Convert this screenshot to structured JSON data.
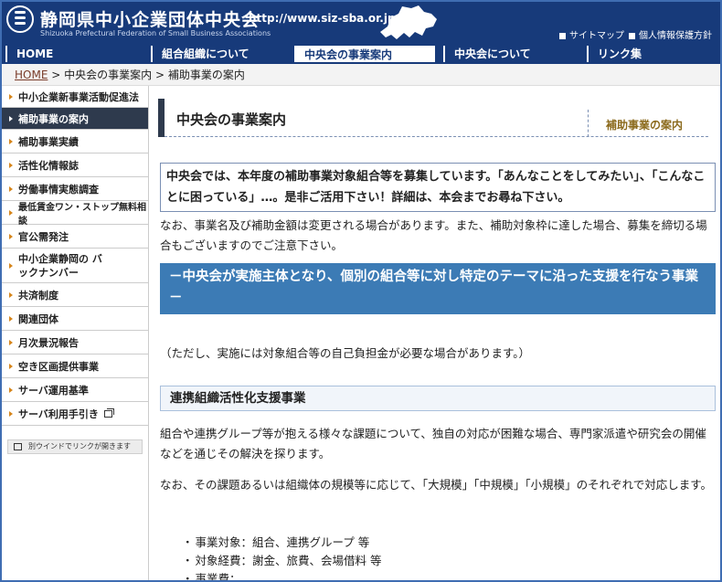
{
  "header": {
    "title": "静岡県中小企業団体中央会",
    "url": "http://www.siz-sba.or.jp/",
    "subtitle": "Shizuoka Prefectural Federation of Small Business Associations",
    "links": [
      "サイトマップ",
      "個人情報保護方針"
    ]
  },
  "nav": {
    "tabs": [
      "HOME",
      "組合組織について",
      "中央会の事業案内",
      "中央会について",
      "リンク集"
    ],
    "active_index": 2
  },
  "breadcrumb": {
    "home": "HOME",
    "sep": ">",
    "items": [
      "中央会の事業案内",
      "補助事業の案内"
    ]
  },
  "sidebar": {
    "items": [
      "中小企業新事業活動促進法",
      "補助事業の案内",
      "補助事業実績",
      "活性化情報誌",
      "労働事情実態調査",
      "最低賃金ワン・ストップ無料相談",
      "官公需発注",
      "中小企業静岡の バックナンバー",
      "共済制度",
      "関連団体",
      "月次景況報告",
      "空き区画提供事業",
      "サーバ運用基準",
      "サーバ利用手引き"
    ],
    "active_index": 1,
    "note": "別ウインドでリンクが開きます"
  },
  "main": {
    "title": "中央会の事業案内",
    "subtitle": "補助事業の案内",
    "notice": "中央会では、本年度の補助事業対象組合等を募集しています。「あんなことをしてみたい」、「こんなことに困っている」…。是非ご活用下さい！詳細は、本会までお尋ね下さい。",
    "note": "なお、事業名及び補助金額は変更される場合があります。また、補助対象枠に達した場合、募集を締切る場合もございますのでご注意下さい。",
    "banner": "－中央会が実施主体となり、個別の組合等に対し特定のテーマに沿った支援を行なう事業－",
    "caution": "（ただし、実施には対象組合等の自己負担金が必要な場合があります。）",
    "section_heading": "連携組織活性化支援事業",
    "para1": "組合や連携グループ等が抱える様々な課題について、独自の対応が困難な場合、専門家派遣や研究会の開催などを通じその解決を探ります。",
    "para2": "なお、その課題あるいは組織体の規模等に応じて、「大規模」「中規模」「小規模」のそれぞれで対応します。",
    "bullets": [
      "事業対象：組合、連携グループ 等",
      "対象経費：謝金、旅費、会場借料 等",
      "事業費："
    ]
  }
}
